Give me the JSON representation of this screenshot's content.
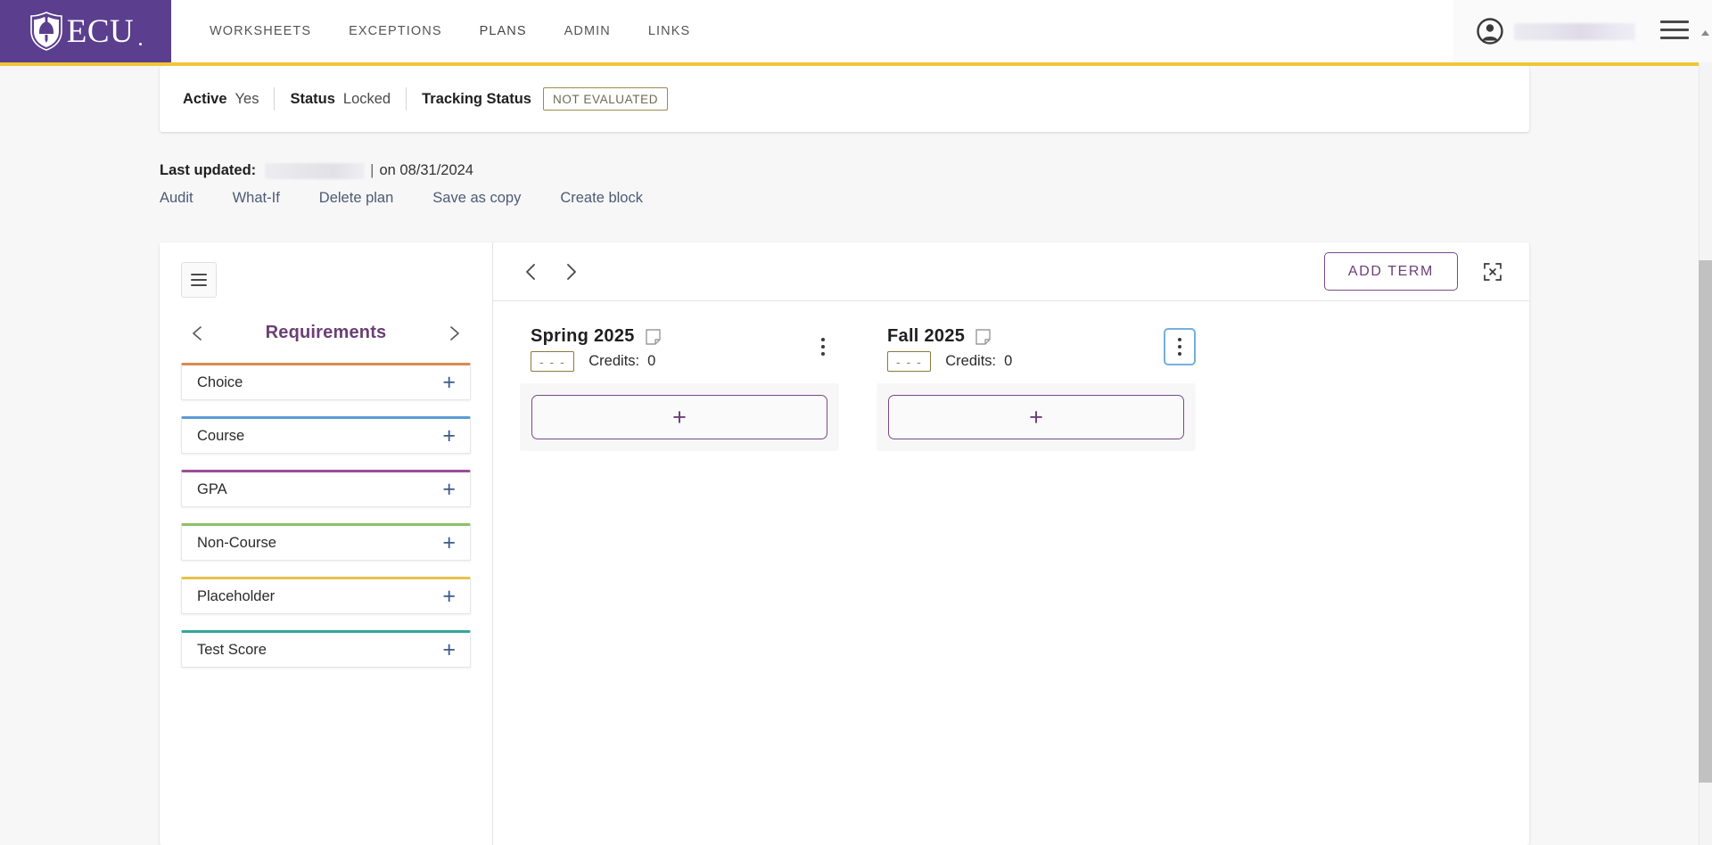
{
  "topnav": {
    "logo": {
      "word": "ECU",
      "icon": "ecu-shield-crest-icon"
    },
    "links": [
      {
        "label": "WORKSHEETS",
        "active": false
      },
      {
        "label": "EXCEPTIONS",
        "active": false
      },
      {
        "label": "PLANS",
        "active": true
      },
      {
        "label": "ADMIN",
        "active": false
      },
      {
        "label": "LINKS",
        "active": false
      }
    ],
    "user": {
      "icon": "user-avatar-icon",
      "name_redacted": true
    },
    "menu_icon": "hamburger-menu-icon",
    "accent_color": "#f2c537",
    "brand_color": "#5b3f8e"
  },
  "status": {
    "active_label": "Active",
    "active_value": "Yes",
    "status_label": "Status",
    "status_value": "Locked",
    "tracking_label": "Tracking Status",
    "tracking_badge": "NOT EVALUATED",
    "badge_border_color": "#9c8a4e"
  },
  "meta": {
    "last_updated_label": "Last updated:",
    "separator": "|",
    "on_text": "on 08/31/2024",
    "links": [
      {
        "label": "Audit"
      },
      {
        "label": "What-If"
      },
      {
        "label": "Delete plan"
      },
      {
        "label": "Save as copy"
      },
      {
        "label": "Create block"
      }
    ]
  },
  "sidebar": {
    "menu_icon": "hamburger-menu-icon",
    "prev_icon": "chevron-left-icon",
    "next_icon": "chevron-right-icon",
    "title": "Requirements",
    "title_color": "#6b3f75",
    "items": [
      {
        "label": "Choice",
        "color": "#d98a4e",
        "add_icon": "plus-icon"
      },
      {
        "label": "Course",
        "color": "#5b9bd5",
        "add_icon": "plus-icon"
      },
      {
        "label": "GPA",
        "color": "#9b4f96",
        "add_icon": "plus-icon"
      },
      {
        "label": "Non-Course",
        "color": "#8dc06a",
        "add_icon": "plus-icon"
      },
      {
        "label": "Placeholder",
        "color": "#e8c24a",
        "add_icon": "plus-icon"
      },
      {
        "label": "Test Score",
        "color": "#34a69a",
        "add_icon": "plus-icon"
      }
    ]
  },
  "toolbar": {
    "prev_icon": "chevron-left-icon",
    "next_icon": "chevron-right-icon",
    "add_term_label": "ADD TERM",
    "expand_icon": "expand-fullscreen-icon",
    "accent_color": "#6b3f75"
  },
  "terms": [
    {
      "title": "Spring 2025",
      "note_icon": "note-page-icon",
      "grade_badge": "- - -",
      "credits_label": "Credits:",
      "credits_value": "0",
      "menu_icon": "kebab-menu-icon",
      "menu_focused": false,
      "add_icon": "plus-icon"
    },
    {
      "title": "Fall 2025",
      "note_icon": "note-page-icon",
      "grade_badge": "- - -",
      "credits_label": "Credits:",
      "credits_value": "0",
      "menu_icon": "kebab-menu-icon",
      "menu_focused": true,
      "add_icon": "plus-icon"
    }
  ],
  "scrollbar": {
    "visible": true,
    "up_arrow_icon": "scroll-up-arrow-icon"
  }
}
